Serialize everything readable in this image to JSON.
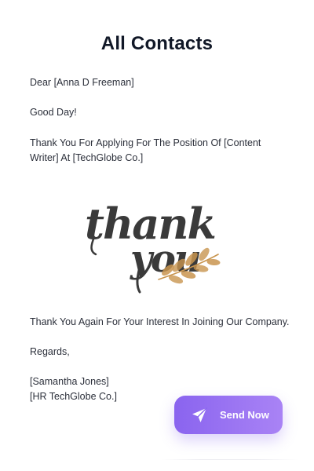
{
  "page_title": "All Contacts",
  "letter": {
    "greeting": "Dear [Anna D Freeman]",
    "salutation": "Good Day!",
    "paragraph_1_line_1": "Thank You For Applying For The Position Of [Content",
    "paragraph_1_line_2": "Writer] At [TechGlobe Co.]",
    "illustration": {
      "word_1": "thank",
      "word_2": "you",
      "text_color": "#3a3a3a",
      "leaf_color": "#c9954f"
    },
    "paragraph_2": "Thank You Again For Your Interest In Joining Our Company.",
    "closing": "Regards,",
    "signature_name": "[Samantha Jones]",
    "signature_company": "[HR TechGlobe Co.]"
  },
  "send_button": {
    "label": "Send Now",
    "icon": "send-icon",
    "color_start": "#8a64ef",
    "color_end": "#a983f5"
  }
}
